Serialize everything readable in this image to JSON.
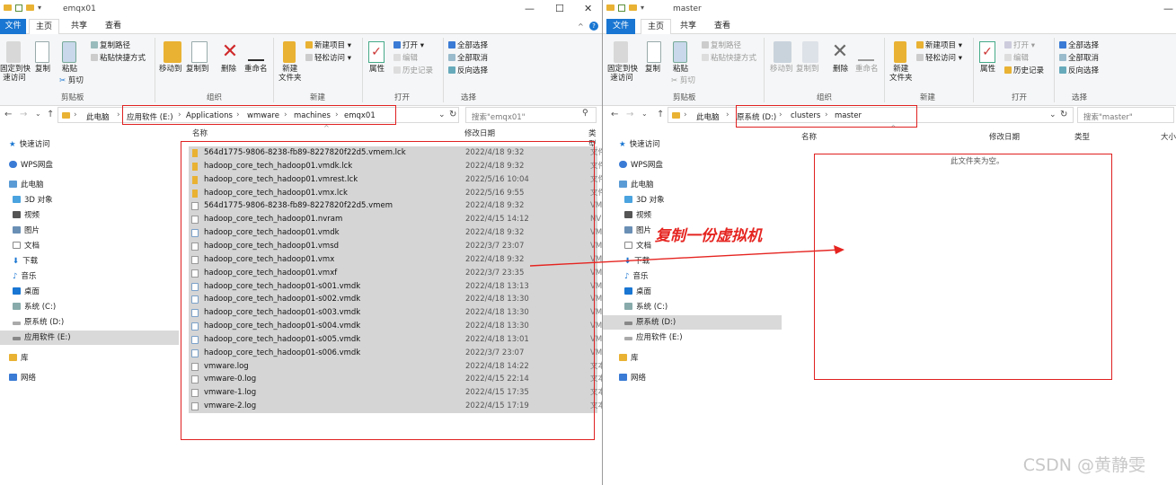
{
  "left_window": {
    "title": "emqx01",
    "tabs": [
      "文件",
      "主页",
      "共享",
      "查看"
    ],
    "ribbon": {
      "clipboard": {
        "pin": "固定到快\n速访问",
        "copy": "复制",
        "paste": "粘贴",
        "copy_path": "复制路径",
        "paste_shortcut": "粘贴快捷方式",
        "cut": "剪切",
        "group": "剪贴板"
      },
      "organize": {
        "move_to": "移动到",
        "copy_to": "复制到",
        "delete": "删除",
        "rename": "重命名",
        "group": "组织"
      },
      "new": {
        "new_item": "新建项目 ▾",
        "easy_access": "轻松访问 ▾",
        "new_folder": "新建\n文件夹",
        "group": "新建"
      },
      "open": {
        "properties": "属性",
        "open": "打开 ▾",
        "edit": "编辑",
        "history": "历史记录",
        "group": "打开"
      },
      "select": {
        "select_all": "全部选择",
        "select_none": "全部取消",
        "invert": "反向选择",
        "group": "选择"
      }
    },
    "breadcrumb": [
      "此电脑",
      "应用软件 (E:)",
      "Applications",
      "wmware",
      "machines",
      "emqx01"
    ],
    "search_placeholder": "搜索\"emqx01\"",
    "columns": {
      "name": "名称",
      "date": "修改日期",
      "type": "类型"
    },
    "files": [
      {
        "name": "564d1775-9806-8238-fb89-8227820f22d5.vmem.lck",
        "date": "2022/4/18 9:32",
        "type": "文件",
        "icon": "folder-icon"
      },
      {
        "name": "hadoop_core_tech_hadoop01.vmdk.lck",
        "date": "2022/4/18 9:32",
        "type": "文件",
        "icon": "folder-icon"
      },
      {
        "name": "hadoop_core_tech_hadoop01.vmrest.lck",
        "date": "2022/5/16 10:04",
        "type": "文件",
        "icon": "folder-icon"
      },
      {
        "name": "hadoop_core_tech_hadoop01.vmx.lck",
        "date": "2022/5/16 9:55",
        "type": "文件",
        "icon": "folder-icon"
      },
      {
        "name": "564d1775-9806-8238-fb89-8227820f22d5.vmem",
        "date": "2022/4/18 9:32",
        "type": "VM",
        "icon": "file-icon"
      },
      {
        "name": "hadoop_core_tech_hadoop01.nvram",
        "date": "2022/4/15 14:12",
        "type": "NV",
        "icon": "file-icon"
      },
      {
        "name": "hadoop_core_tech_hadoop01.vmdk",
        "date": "2022/4/18 9:32",
        "type": "VM",
        "icon": "disk-icon"
      },
      {
        "name": "hadoop_core_tech_hadoop01.vmsd",
        "date": "2022/3/7 23:07",
        "type": "VM",
        "icon": "file-icon"
      },
      {
        "name": "hadoop_core_tech_hadoop01.vmx",
        "date": "2022/4/18 9:32",
        "type": "VM",
        "icon": "file-icon"
      },
      {
        "name": "hadoop_core_tech_hadoop01.vmxf",
        "date": "2022/3/7 23:35",
        "type": "VM",
        "icon": "file-icon"
      },
      {
        "name": "hadoop_core_tech_hadoop01-s001.vmdk",
        "date": "2022/4/18 13:13",
        "type": "VM",
        "icon": "disk-icon"
      },
      {
        "name": "hadoop_core_tech_hadoop01-s002.vmdk",
        "date": "2022/4/18 13:30",
        "type": "VM",
        "icon": "disk-icon"
      },
      {
        "name": "hadoop_core_tech_hadoop01-s003.vmdk",
        "date": "2022/4/18 13:30",
        "type": "VM",
        "icon": "disk-icon"
      },
      {
        "name": "hadoop_core_tech_hadoop01-s004.vmdk",
        "date": "2022/4/18 13:30",
        "type": "VM",
        "icon": "disk-icon"
      },
      {
        "name": "hadoop_core_tech_hadoop01-s005.vmdk",
        "date": "2022/4/18 13:01",
        "type": "VM",
        "icon": "disk-icon"
      },
      {
        "name": "hadoop_core_tech_hadoop01-s006.vmdk",
        "date": "2022/3/7 23:07",
        "type": "VM",
        "icon": "disk-icon"
      },
      {
        "name": "vmware.log",
        "date": "2022/4/18 14:22",
        "type": "文本",
        "icon": "file-icon"
      },
      {
        "name": "vmware-0.log",
        "date": "2022/4/15 22:14",
        "type": "文本",
        "icon": "file-icon"
      },
      {
        "name": "vmware-1.log",
        "date": "2022/4/15 17:35",
        "type": "文本",
        "icon": "file-icon"
      },
      {
        "name": "vmware-2.log",
        "date": "2022/4/15 17:19",
        "type": "文本",
        "icon": "file-icon"
      }
    ],
    "nav": [
      "快速访问",
      "WPS网盘",
      "此电脑",
      "3D 对象",
      "视频",
      "图片",
      "文档",
      "下载",
      "音乐",
      "桌面",
      "系统 (C:)",
      "原系统 (D:)",
      "应用软件 (E:)",
      "库",
      "网络"
    ]
  },
  "right_window": {
    "title": "master",
    "tabs": [
      "文件",
      "主页",
      "共享",
      "查看"
    ],
    "breadcrumb": [
      "此电脑",
      "原系统 (D:)",
      "clusters",
      "master"
    ],
    "search_placeholder": "搜索\"master\"",
    "columns": {
      "name": "名称",
      "date": "修改日期",
      "type": "类型",
      "size": "大小"
    },
    "empty_text": "此文件夹为空。",
    "nav": [
      "快速访问",
      "WPS网盘",
      "此电脑",
      "3D 对象",
      "视频",
      "图片",
      "文档",
      "下载",
      "音乐",
      "桌面",
      "系统 (C:)",
      "原系统 (D:)",
      "应用软件 (E:)",
      "库",
      "网络"
    ]
  },
  "annotation": "复制一份虚拟机",
  "watermark": "CSDN @黄静雯",
  "colors": {
    "annotation_red": "#e52420",
    "file_tab_blue": "#1976d2",
    "selection_gray": "#d5d5d5",
    "folder_yellow": "#e9b233"
  }
}
